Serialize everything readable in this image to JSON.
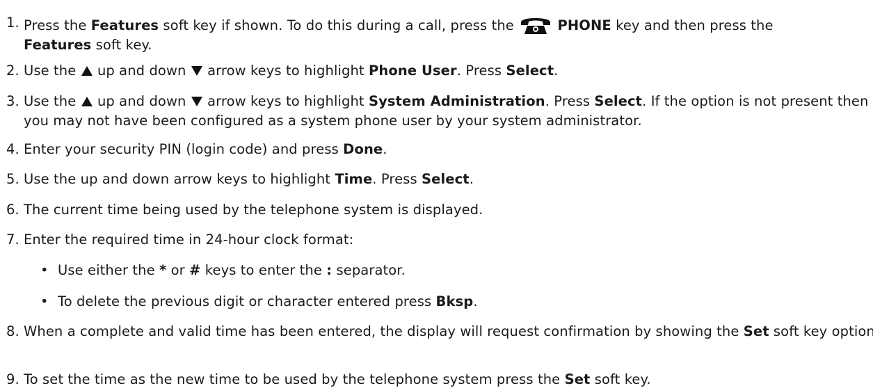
{
  "icons": {
    "phone": "phone-icon",
    "up": "up-arrow-icon",
    "down": "down-arrow-icon"
  },
  "steps": [
    {
      "num": "1.",
      "a": "Press the ",
      "b": "Features",
      "c": " soft key if shown. To do this during a call, press the ",
      "d": "PHONE",
      "e": " key and then press the ",
      "f": "Features",
      "g": " soft key."
    },
    {
      "num": "2.",
      "a": "Use the ",
      "b": " up and down ",
      "c": " arrow keys to highlight ",
      "d": "Phone User",
      "e": ". Press ",
      "f": "Select",
      "g": "."
    },
    {
      "num": "3.",
      "a": "Use the ",
      "b": " up and down ",
      "c": " arrow keys to highlight ",
      "d": "System Administration",
      "e": ". Press ",
      "f": "Select",
      "g": ". If the option is not present then you may not have been configured as a system phone user by your system administrator."
    },
    {
      "num": "4.",
      "a": "Enter your security PIN (login code) and press ",
      "b": "Done",
      "c": "."
    },
    {
      "num": "5.",
      "a": "Use the up and down arrow keys to highlight ",
      "b": "Time",
      "c": ". Press ",
      "d": "Select",
      "e": "."
    },
    {
      "num": "6.",
      "a": "The current time being used by the telephone system is displayed."
    },
    {
      "num": "7.",
      "a": "Enter the required time in 24-hour clock format:",
      "bullets": [
        {
          "a": "Use either the ",
          "b": "*",
          "c": " or ",
          "d": "#",
          "e": " keys to enter the ",
          "f": ":",
          "g": " separator."
        },
        {
          "a": "To delete the previous digit or character entered press ",
          "b": "Bksp",
          "c": "."
        }
      ]
    },
    {
      "num": "8.",
      "a": "When a complete and valid time has been entered, the display will request confirmation by showing the ",
      "b": "Set",
      "c": " soft key option."
    },
    {
      "num": "9.",
      "a": "To set the time as the new time to be used by the telephone system press the ",
      "b": "Set",
      "c": " soft key."
    }
  ]
}
